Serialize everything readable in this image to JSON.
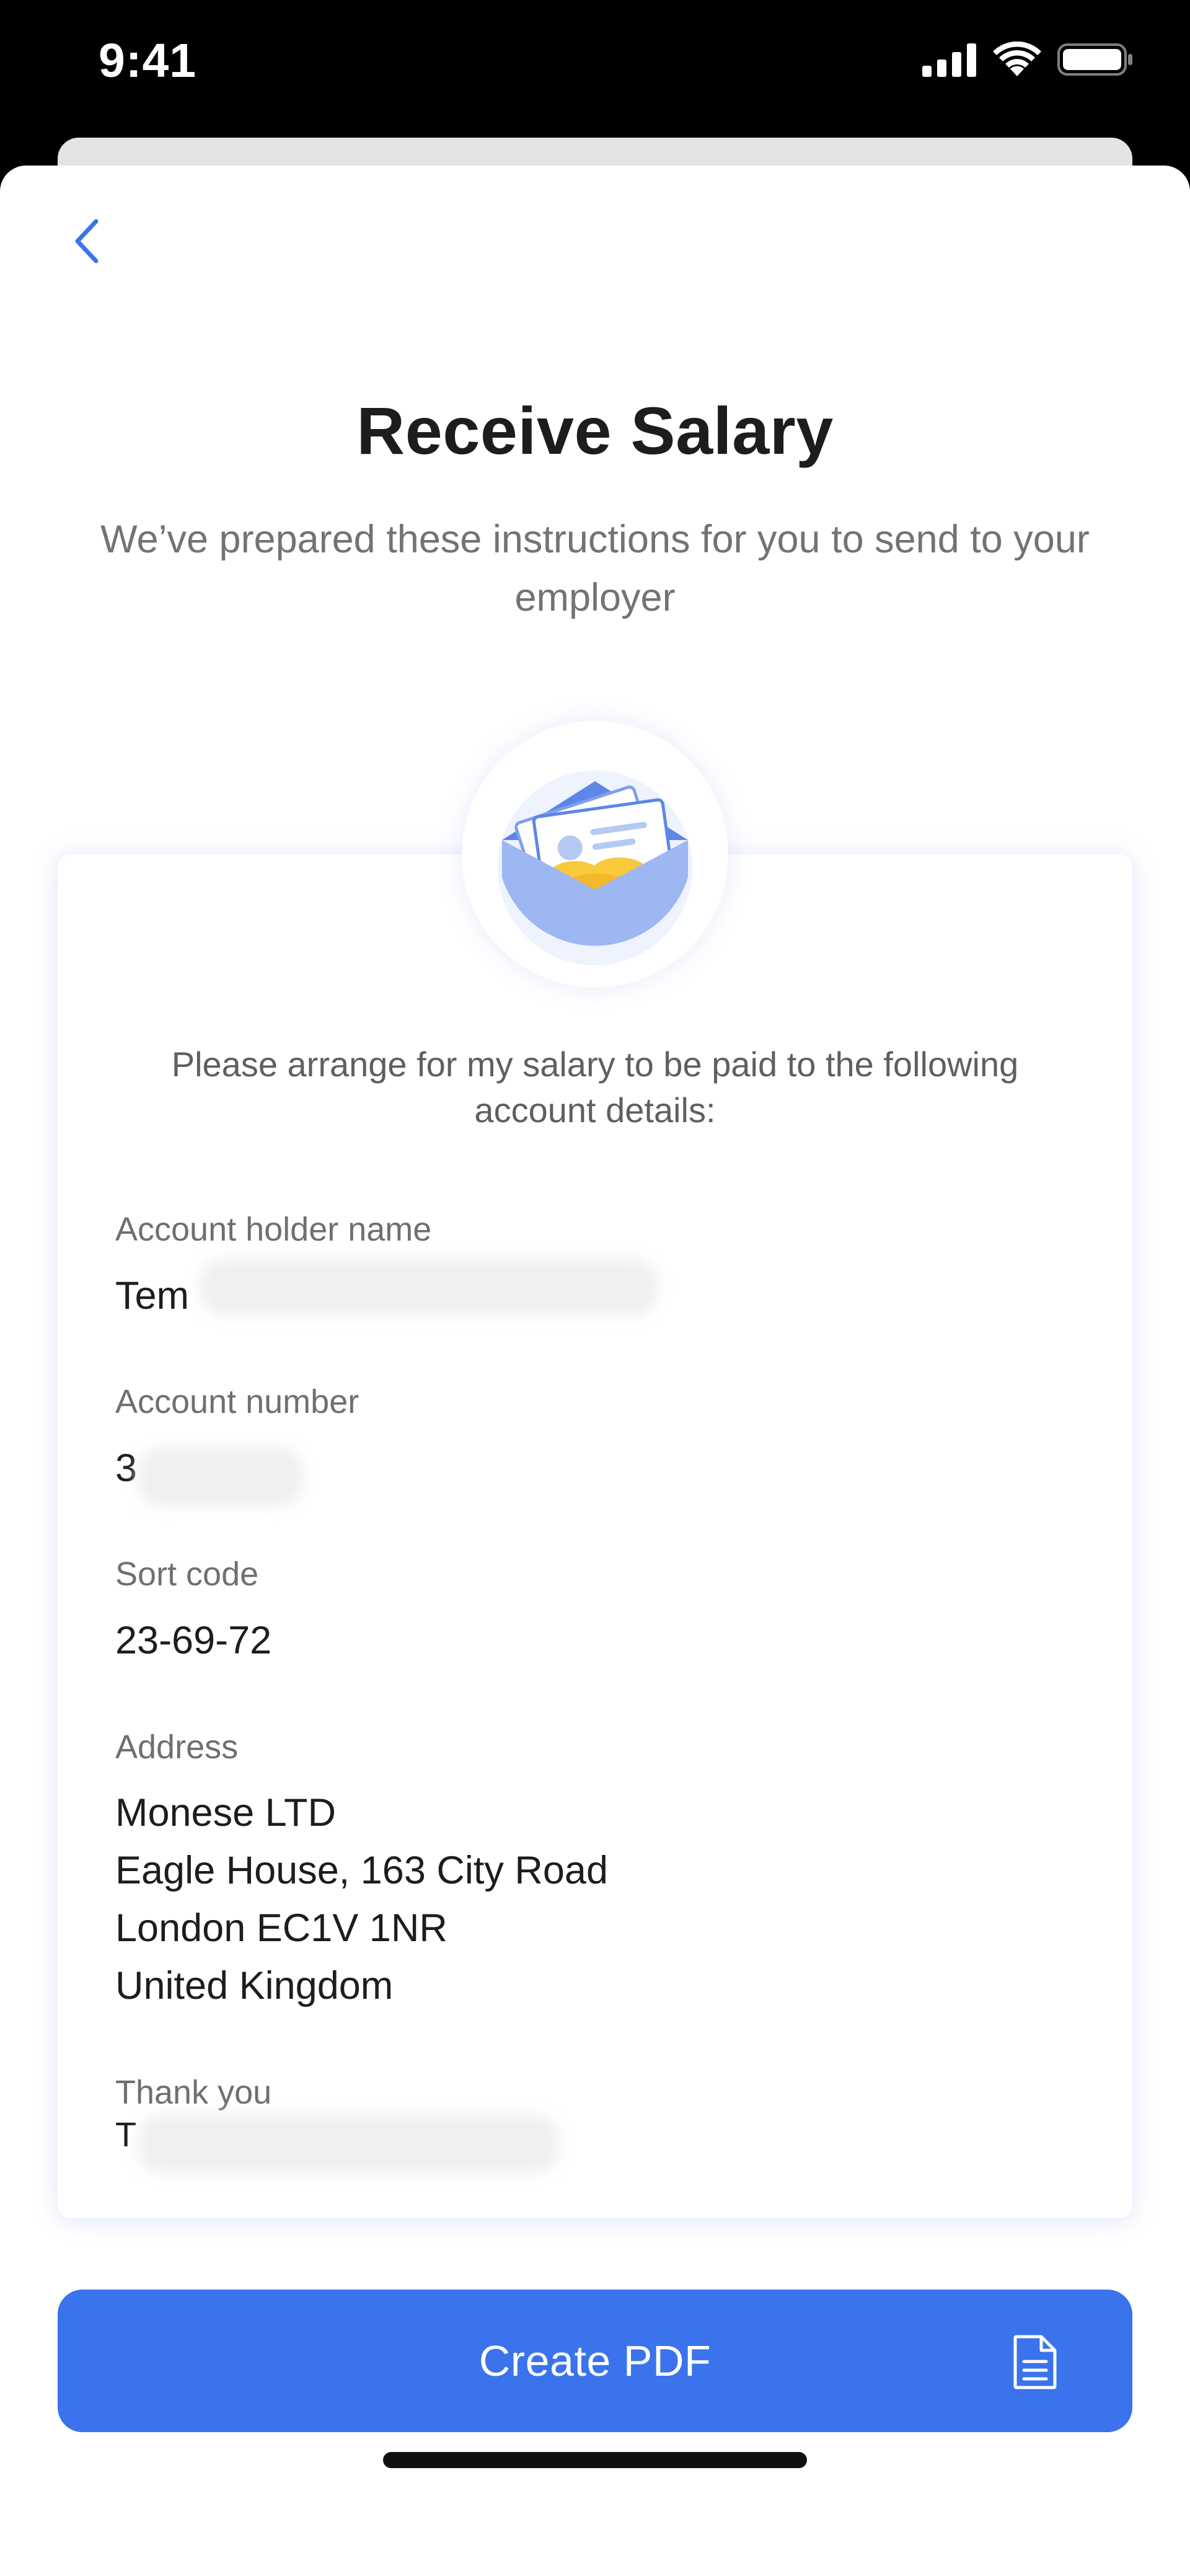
{
  "status_bar": {
    "time": "9:41"
  },
  "header": {
    "back_icon": "chevron-left-icon",
    "title": "Receive Salary",
    "subtitle": "We’ve prepared these instructions for you to send to your employer"
  },
  "card": {
    "illustration_icon": "envelope-with-payslip-icon",
    "intro": "Please arrange for my salary to be paid to the following account details:",
    "fields": [
      {
        "label": "Account holder name",
        "value": "Tem"
      },
      {
        "label": "Account number",
        "value": "3"
      },
      {
        "label": "Sort code",
        "value": "23-69-72"
      },
      {
        "label": "Address",
        "value_lines": [
          "Monese LTD",
          "Eagle House, 163 City Road",
          "London EC1V 1NR",
          "United Kingdom"
        ]
      }
    ],
    "sign_off_label": "Thank you",
    "sign_off_value": "T"
  },
  "actions": {
    "create_pdf_label": "Create PDF",
    "create_pdf_icon": "document-icon"
  },
  "colors": {
    "accent": "#3a73ec",
    "title": "#1d1d1f",
    "muted": "#737373"
  }
}
